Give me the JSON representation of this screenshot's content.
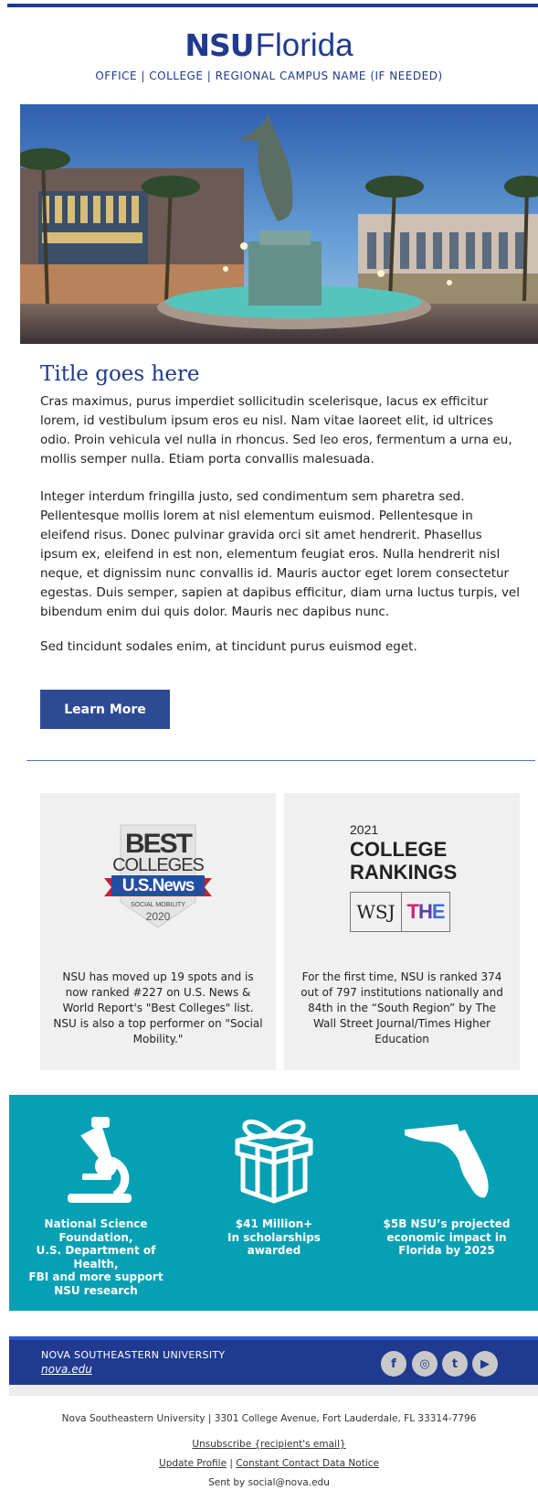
{
  "header": {
    "logo_bold": "NSU",
    "logo_light": "Florida",
    "subheading": "OFFICE | COLLEGE | REGIONAL CAMPUS NAME (IF NEEDED)"
  },
  "article": {
    "title": "Title goes here",
    "paragraphs": [
      "Cras maximus, purus imperdiet sollicitudin scelerisque, lacus ex efficitur lorem, id vestibulum ipsum eros eu nisl. Nam vitae laoreet elit, id ultrices odio. Proin vehicula vel nulla in rhoncus. Sed leo eros, fermentum a urna eu, mollis semper nulla. Etiam porta convallis malesuada.",
      "Integer interdum fringilla justo, sed condimentum sem pharetra sed. Pellentesque mollis lorem at nisl elementum euismod. Pellentesque in eleifend risus. Donec pulvinar gravida orci sit amet hendrerit. Phasellus ipsum ex, eleifend in est non, elementum feugiat eros. Nulla hendrerit nisl neque, et dignissim nunc convallis id. Mauris auctor eget lorem consectetur egestas. Duis semper, sapien at dapibus efficitur, diam urna luctus turpis, vel bibendum enim dui quis dolor. Mauris nec dapibus nunc.",
      "Sed tincidunt sodales enim, at tincidunt purus euismod eget."
    ],
    "button_label": "Learn More"
  },
  "cards": {
    "left": {
      "badge_line1": "BEST",
      "badge_line2": "COLLEGES",
      "badge_line3": "U.S.News",
      "badge_line4": "SOCIAL MOBILITY",
      "badge_year": "2020",
      "text": "NSU has moved up 19 spots and is now ranked #227 on U.S. News & World Report's \"Best Colleges\" list. NSU is also a top performer on \"Social Mobility.\""
    },
    "right": {
      "year": "2021",
      "title_line1": "COLLEGE",
      "title_line2": "RANKINGS",
      "logo_wsj": "WSJ",
      "logo_the_1": "T",
      "logo_the_2": "H",
      "logo_the_3": "E",
      "text": "For the first time, NSU is ranked 374 out of 797 institutions nationally and 84th in the “South Region” by The Wall Street Journal/Times Higher Education"
    }
  },
  "stats": [
    {
      "icon": "microscope-icon",
      "lines": [
        "National Science",
        "Foundation,",
        "U.S. Department of",
        "Health,",
        "FBI and more support",
        "NSU research"
      ]
    },
    {
      "icon": "gift-icon",
      "lines": [
        "$41 Million+",
        "In scholarships",
        "awarded"
      ]
    },
    {
      "icon": "florida-icon",
      "lines": [
        "$5B NSU’s projected",
        "economic impact in",
        "Florida by 2025"
      ]
    }
  ],
  "footer": {
    "org_name": "NOVA SOUTHEASTERN UNIVERSITY",
    "site_link": "nova.edu",
    "social": [
      {
        "icon": "facebook-icon",
        "glyph": "f"
      },
      {
        "icon": "instagram-icon",
        "glyph": "◎"
      },
      {
        "icon": "twitter-icon",
        "glyph": "t"
      },
      {
        "icon": "youtube-icon",
        "glyph": "▶"
      }
    ],
    "address": "Nova Southeastern University | 3301 College Avenue, Fort Lauderdale, FL 33314-7796",
    "unsubscribe": "Unsubscribe {recipient's email}",
    "update_profile": "Update Profile",
    "separator": "|",
    "data_notice": "Constant Contact Data Notice",
    "sent_by": "Sent by social@nova.edu"
  },
  "colors": {
    "brand_blue": "#1f3a8f",
    "button_blue": "#2d4a94",
    "teal": "#06a0b4",
    "card_gray": "#f0f0f0"
  }
}
